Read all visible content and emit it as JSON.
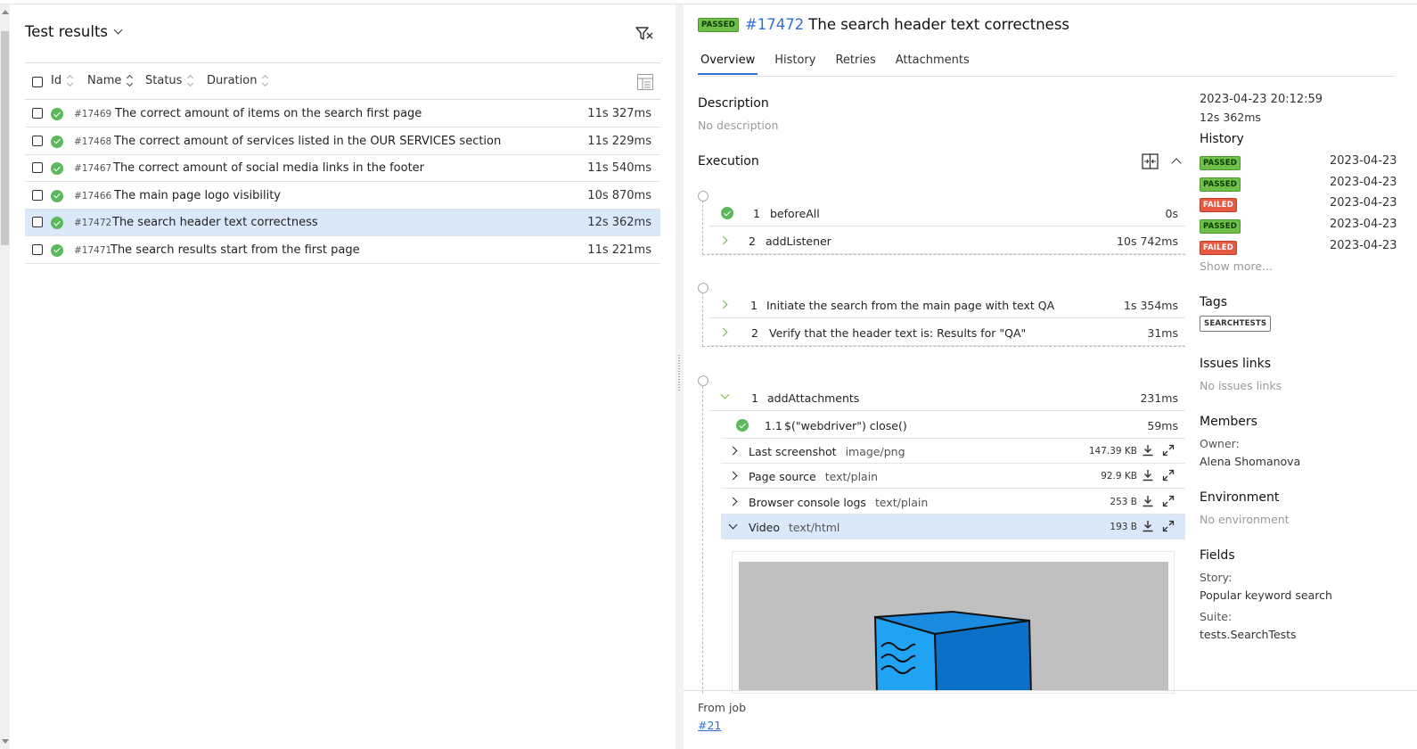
{
  "left": {
    "title": "Test results",
    "columns": {
      "id": "Id",
      "name": "Name",
      "status": "Status",
      "duration": "Duration"
    },
    "rows": [
      {
        "id": "#17469",
        "name": "The correct amount of items on the search first page",
        "duration": "11s 327ms",
        "selected": false
      },
      {
        "id": "#17468",
        "name": "The correct amount of services listed in the OUR SERVICES section",
        "duration": "11s 229ms",
        "selected": false
      },
      {
        "id": "#17467",
        "name": "The correct amount of social media links in the footer",
        "duration": "11s 540ms",
        "selected": false
      },
      {
        "id": "#17466",
        "name": "The main page logo visibility",
        "duration": "10s 870ms",
        "selected": false
      },
      {
        "id": "#17472",
        "name": "The search header text correctness",
        "duration": "12s 362ms",
        "selected": true
      },
      {
        "id": "#17471",
        "name": "The search results start from the first page",
        "duration": "11s 221ms",
        "selected": false
      }
    ]
  },
  "detail": {
    "status": "PASSED",
    "test_id": "#17472",
    "test_name": "The search header text correctness",
    "tabs": [
      "Overview",
      "History",
      "Retries",
      "Attachments"
    ],
    "description_title": "Description",
    "description": "No description",
    "execution_title": "Execution",
    "before_steps": [
      {
        "num": "1",
        "name": "beforeAll",
        "duration": "0s"
      },
      {
        "num": "2",
        "name": "addListener",
        "duration": "10s 742ms"
      }
    ],
    "test_steps": [
      {
        "num": "1",
        "name": "Initiate the search from the main page with text QA",
        "duration": "1s 354ms"
      },
      {
        "num": "2",
        "name": "Verify that the header text is: Results for \"QA\"",
        "duration": "31ms"
      }
    ],
    "after_step": {
      "num": "1",
      "name": "addAttachments",
      "duration": "231ms"
    },
    "after_substep": {
      "num": "1.1",
      "name": "$(\"webdriver\") close()",
      "duration": "59ms"
    },
    "attachments": [
      {
        "name": "Last screenshot",
        "mime": "image/png",
        "size": "147.39 KB"
      },
      {
        "name": "Page source",
        "mime": "text/plain",
        "size": "92.9 KB"
      },
      {
        "name": "Browser console logs",
        "mime": "text/plain",
        "size": "253 B"
      },
      {
        "name": "Video",
        "mime": "text/html",
        "size": "193 B"
      }
    ],
    "footer_label": "From job",
    "footer_link": "#21"
  },
  "side": {
    "started": "2023-04-23 20:12:59",
    "duration": "12s 362ms",
    "history_title": "History",
    "history": [
      {
        "status": "PASSED",
        "date": "2023-04-23"
      },
      {
        "status": "PASSED",
        "date": "2023-04-23"
      },
      {
        "status": "FAILED",
        "date": "2023-04-23"
      },
      {
        "status": "PASSED",
        "date": "2023-04-23"
      },
      {
        "status": "FAILED",
        "date": "2023-04-23"
      }
    ],
    "show_more": "Show more...",
    "tags_title": "Tags",
    "tag": "SEARCHTESTS",
    "issues_title": "Issues links",
    "issues": "No issues links",
    "members_title": "Members",
    "owner_label": "Owner:",
    "owner": "Alena Shomanova",
    "environment_title": "Environment",
    "environment": "No environment",
    "fields_title": "Fields",
    "story_label": "Story:",
    "story": "Popular keyword search",
    "suite_label": "Suite:",
    "suite": "tests.SearchTests"
  },
  "colors": {
    "accent": "#2f6fd6",
    "passed": "#6fc04a",
    "failed": "#e65a43",
    "selected_row": "#dbe8fa"
  }
}
